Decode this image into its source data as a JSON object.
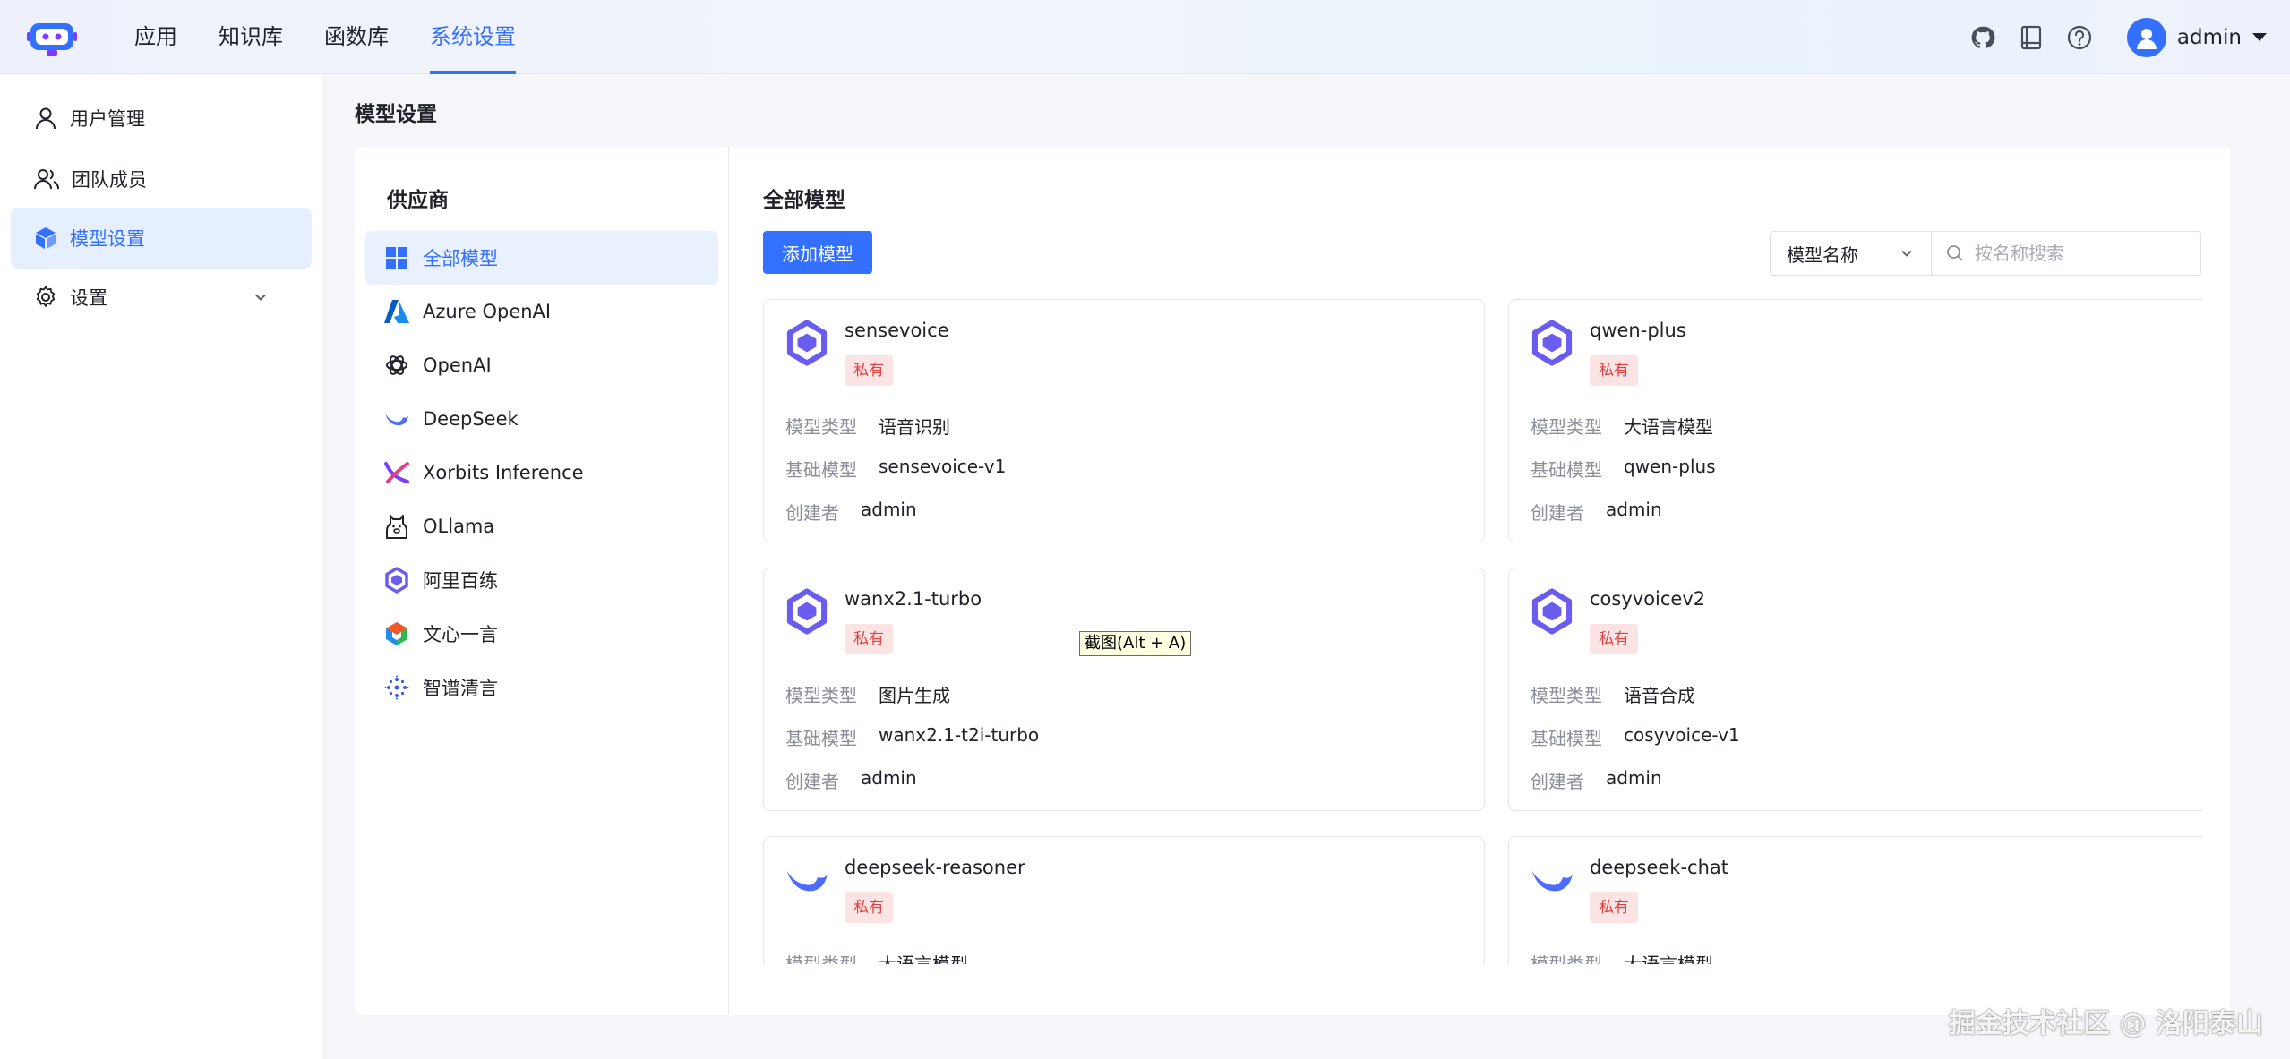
{
  "nav": {
    "items": [
      {
        "label": "应用",
        "active": false
      },
      {
        "label": "知识库",
        "active": false
      },
      {
        "label": "函数库",
        "active": false
      },
      {
        "label": "系统设置",
        "active": true
      }
    ]
  },
  "user": {
    "name": "admin"
  },
  "sidebar": {
    "items": [
      {
        "label": "用户管理",
        "icon": "user-icon"
      },
      {
        "label": "团队成员",
        "icon": "team-icon"
      },
      {
        "label": "模型设置",
        "icon": "cube-icon",
        "active": true
      },
      {
        "label": "设置",
        "icon": "gear-icon"
      }
    ]
  },
  "page": {
    "title": "模型设置"
  },
  "providers": {
    "title": "供应商",
    "items": [
      {
        "label": "全部模型",
        "icon": "grid-icon",
        "active": true
      },
      {
        "label": "Azure OpenAI",
        "icon": "azure-icon"
      },
      {
        "label": "OpenAI",
        "icon": "openai-icon"
      },
      {
        "label": "DeepSeek",
        "icon": "deepseek-icon"
      },
      {
        "label": "Xorbits Inference",
        "icon": "xorbits-icon"
      },
      {
        "label": "OLlama",
        "icon": "ollama-icon"
      },
      {
        "label": "阿里百练",
        "icon": "alibaba-icon"
      },
      {
        "label": "文心一言",
        "icon": "wenxin-icon"
      },
      {
        "label": "智谱清言",
        "icon": "zhipu-icon"
      }
    ]
  },
  "models": {
    "title": "全部模型",
    "add_label": "添加模型",
    "filter_select": "模型名称",
    "search_placeholder": "按名称搜索",
    "labels": {
      "type": "模型类型",
      "base": "基础模型",
      "creator": "创建者"
    },
    "cards": [
      {
        "name": "sensevoice",
        "badge": "私有",
        "type": "语音识别",
        "base": "sensevoice-v1",
        "creator": "admin",
        "icon": "alibaba-icon"
      },
      {
        "name": "qwen-plus",
        "badge": "私有",
        "type": "大语言模型",
        "base": "qwen-plus",
        "creator": "admin",
        "icon": "alibaba-icon"
      },
      {
        "name": "wanx2.1-turbo",
        "badge": "私有",
        "type": "图片生成",
        "base": "wanx2.1-t2i-turbo",
        "creator": "admin",
        "icon": "alibaba-icon"
      },
      {
        "name": "cosyvoicev2",
        "badge": "私有",
        "type": "语音合成",
        "base": "cosyvoice-v1",
        "creator": "admin",
        "icon": "alibaba-icon"
      },
      {
        "name": "deepseek-reasoner",
        "badge": "私有",
        "type": "大语言模型",
        "base": "",
        "creator": "",
        "icon": "deepseek-icon"
      },
      {
        "name": "deepseek-chat",
        "badge": "私有",
        "type": "大语言模型",
        "base": "",
        "creator": "",
        "icon": "deepseek-icon"
      }
    ]
  },
  "tooltip": {
    "text": "截图(Alt + A)"
  },
  "watermark": {
    "text": "掘金技术社区 @ 洛阳泰山"
  },
  "colors": {
    "accent": "#3370ff",
    "badge_bg": "#fde4e4",
    "badge_text": "#e0403d"
  }
}
